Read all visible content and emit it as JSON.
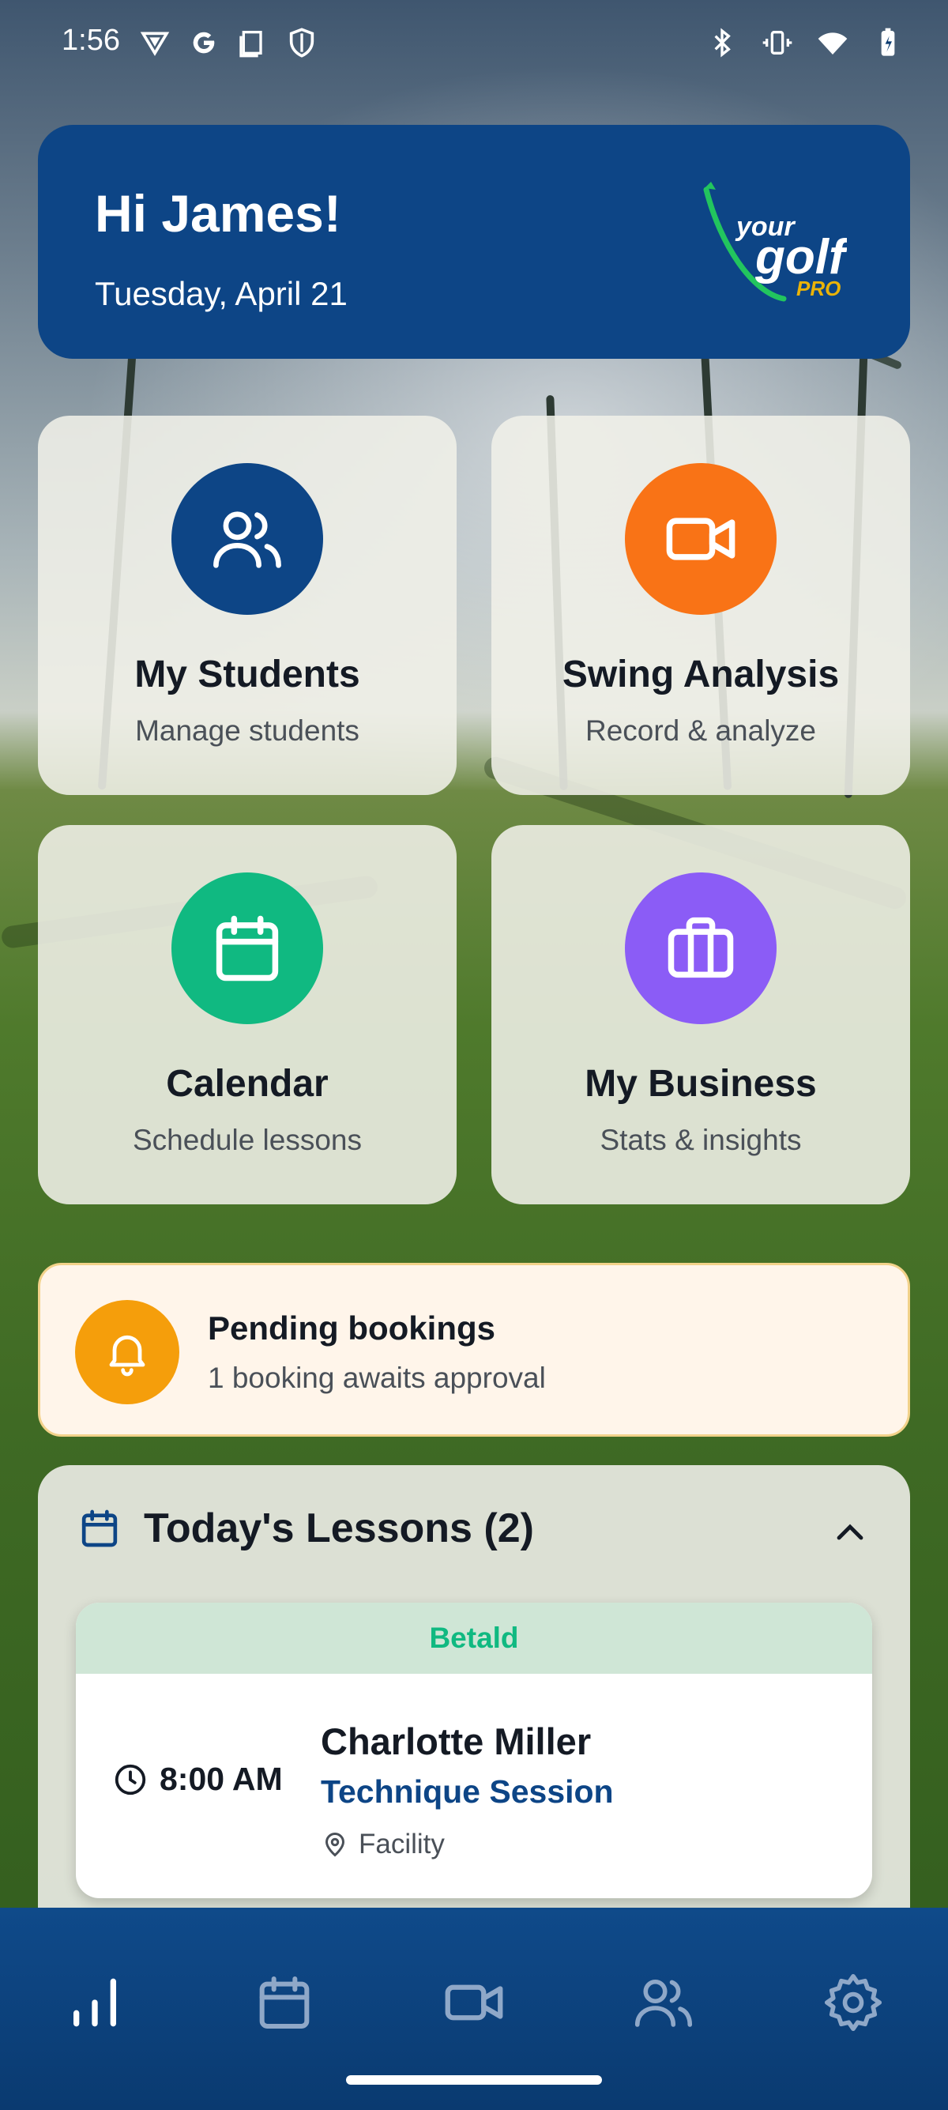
{
  "status_bar": {
    "time": "1:56",
    "left_icons": [
      "vpn-icon",
      "google-icon",
      "screenshot-icon",
      "shield-icon"
    ],
    "right_icons": [
      "bluetooth-icon",
      "vibrate-icon",
      "wifi-icon",
      "battery-icon"
    ]
  },
  "header": {
    "greeting": "Hi James!",
    "date": "Tuesday, April 21",
    "logo": {
      "word1": "your",
      "word2": "golf",
      "word3": "PRO"
    }
  },
  "tiles": [
    {
      "title": "My Students",
      "subtitle": "Manage students",
      "icon": "users-icon",
      "color": "#0d4586"
    },
    {
      "title": "Swing Analysis",
      "subtitle": "Record & analyze",
      "icon": "video-camera-icon",
      "color": "#f97316"
    },
    {
      "title": "Calendar",
      "subtitle": "Schedule lessons",
      "icon": "calendar-icon",
      "color": "#10b981"
    },
    {
      "title": "My Business",
      "subtitle": "Stats & insights",
      "icon": "briefcase-icon",
      "color": "#8b5cf6"
    }
  ],
  "pending": {
    "title": "Pending bookings",
    "subtitle": "1 booking awaits approval",
    "icon": "bell-icon",
    "color": "#f59e0b"
  },
  "lessons": {
    "title": "Today's Lessons (2)",
    "items": [
      {
        "status": "Betald",
        "time": "8:00 AM",
        "student": "Charlotte Miller",
        "type": "Technique Session",
        "location": "Facility"
      }
    ]
  },
  "bottom_nav": {
    "items": [
      "stats-icon",
      "calendar-icon",
      "video-camera-icon",
      "users-icon",
      "settings-icon"
    ]
  }
}
